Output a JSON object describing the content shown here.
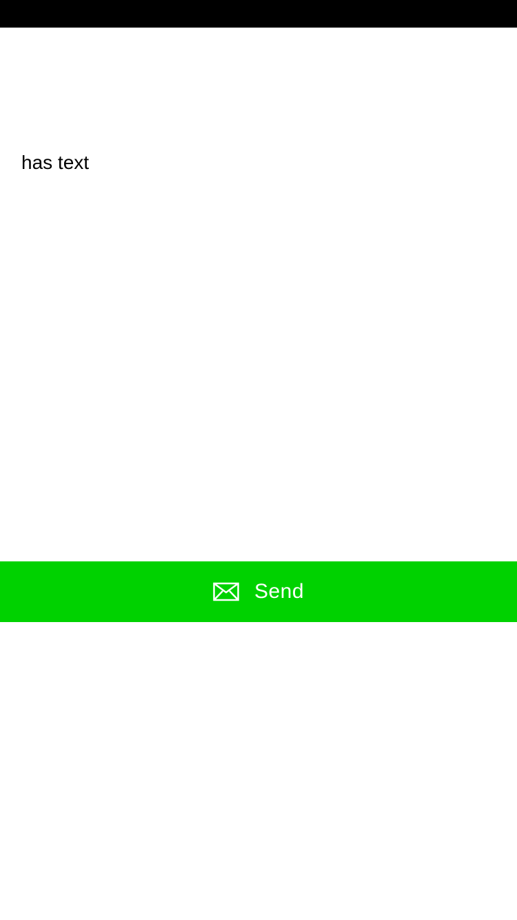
{
  "message": {
    "text": "has text"
  },
  "send_button": {
    "label": "Send",
    "icon": "envelope-icon"
  },
  "colors": {
    "status_bar": "#000000",
    "background": "#ffffff",
    "send_button_bg": "#00d200",
    "send_button_text": "#ffffff",
    "message_text": "#000000"
  }
}
